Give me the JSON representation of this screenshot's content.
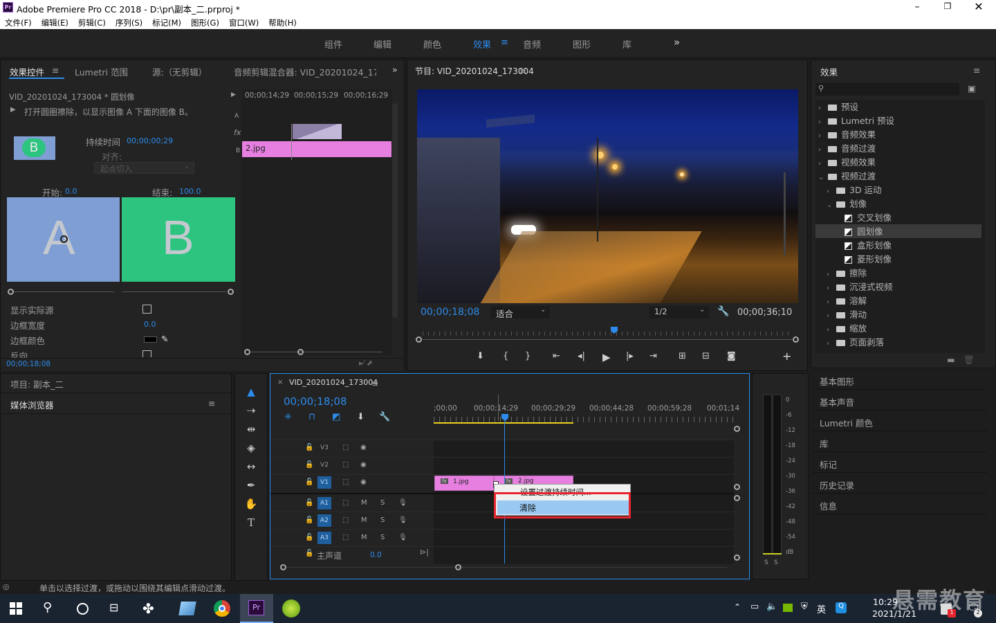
{
  "window": {
    "title": "Adobe Premiere Pro CC 2018 - D:\\pr\\副本_二.prproj *",
    "logo": "Pr"
  },
  "menu": [
    "文件(F)",
    "编辑(E)",
    "剪辑(C)",
    "序列(S)",
    "标记(M)",
    "图形(G)",
    "窗口(W)",
    "帮助(H)"
  ],
  "workspaces": {
    "items": [
      "组件",
      "编辑",
      "颜色",
      "效果",
      "音频",
      "图形",
      "库"
    ],
    "active": "效果",
    "more": "»"
  },
  "effect_controls": {
    "tabs": [
      "效果控件",
      "Lumetri 范围",
      "源:（无剪辑）",
      "音频剪辑混合器: VID_20201024_17300"
    ],
    "clip_title": "VID_20201024_173004 * 圆划像",
    "description": "打开圆圈擦除，以显示图像 A 下面的图像 B。",
    "thumb_letter": "B",
    "duration_label": "持续时间",
    "duration_value": "00;00;00;29",
    "align_label": "对齐:",
    "align_value": "起点切入",
    "start_label": "开始:",
    "start_value": "0.0",
    "end_label": "结束:",
    "end_value": "100.0",
    "preview_a": "A",
    "preview_b": "B",
    "props": [
      {
        "label": "显示实际源",
        "value": ""
      },
      {
        "label": "边框宽度",
        "value": "0.0"
      },
      {
        "label": "边框颜色",
        "value": ""
      },
      {
        "label": "反向",
        "value": ""
      }
    ],
    "timecode_bottom": "00;00;18;08",
    "mini_ruler": [
      "00;00;14;29",
      "00;00;15;29",
      "00;00;16;29"
    ],
    "mini_clip": "2.jpg",
    "track_a": "A",
    "track_b": "B",
    "fx_label": "fx"
  },
  "program": {
    "title": "节目: VID_20201024_173004",
    "timecode": "00;00;18;08",
    "fit": "适合",
    "quality": "1/2",
    "duration": "00;00;36;10"
  },
  "effects": {
    "title": "效果",
    "items": [
      {
        "label": "预设",
        "kind": "preset",
        "indent": 0,
        "chev": "›"
      },
      {
        "label": "Lumetri 预设",
        "kind": "preset",
        "indent": 0,
        "chev": "›"
      },
      {
        "label": "音频效果",
        "kind": "folder",
        "indent": 0,
        "chev": "›"
      },
      {
        "label": "音频过渡",
        "kind": "folder",
        "indent": 0,
        "chev": "›"
      },
      {
        "label": "视频效果",
        "kind": "folder",
        "indent": 0,
        "chev": "›"
      },
      {
        "label": "视频过渡",
        "kind": "folder",
        "indent": 0,
        "chev": "⌄"
      },
      {
        "label": "3D 运动",
        "kind": "folder",
        "indent": 1,
        "chev": "›"
      },
      {
        "label": "划像",
        "kind": "folder",
        "indent": 1,
        "chev": "⌄"
      },
      {
        "label": "交叉划像",
        "kind": "trans",
        "indent": 2,
        "chev": ""
      },
      {
        "label": "圆划像",
        "kind": "trans",
        "indent": 2,
        "chev": "",
        "selected": true
      },
      {
        "label": "盒形划像",
        "kind": "trans",
        "indent": 2,
        "chev": ""
      },
      {
        "label": "菱形划像",
        "kind": "trans",
        "indent": 2,
        "chev": ""
      },
      {
        "label": "擦除",
        "kind": "folder",
        "indent": 1,
        "chev": "›"
      },
      {
        "label": "沉浸式视频",
        "kind": "folder",
        "indent": 1,
        "chev": "›"
      },
      {
        "label": "溶解",
        "kind": "folder",
        "indent": 1,
        "chev": "›"
      },
      {
        "label": "滑动",
        "kind": "folder",
        "indent": 1,
        "chev": "›"
      },
      {
        "label": "缩放",
        "kind": "folder",
        "indent": 1,
        "chev": "›"
      },
      {
        "label": "页面剥落",
        "kind": "folder",
        "indent": 1,
        "chev": "›"
      }
    ],
    "panels": [
      "基本图形",
      "基本声音",
      "Lumetri 颜色",
      "库",
      "标记",
      "历史记录",
      "信息"
    ]
  },
  "project": {
    "title": "项目: 副本_二",
    "browser": "媒体浏览器"
  },
  "timeline": {
    "title": "VID_20201024_173004",
    "timecode": "00;00;18;08",
    "ruler": [
      ";00;00",
      "00;00;14;29",
      "00;00;29;29",
      "00;00;44;28",
      "00;00;59;28",
      "00;01;14"
    ],
    "video_tracks": [
      "V3",
      "V2",
      "V1"
    ],
    "audio_tracks": [
      "A1",
      "A2",
      "A3"
    ],
    "master": "主声道",
    "master_value": "0.0",
    "clip1": "1.jpg",
    "clip2": "2.jpg",
    "fx_badge": "fx",
    "m": "M",
    "s": "S",
    "context_menu": [
      "设置过渡持续时间...",
      "清除"
    ]
  },
  "meter": {
    "labels": [
      "0",
      "-6",
      "-12",
      "-18",
      "-24",
      "-30",
      "-36",
      "-42",
      "-48",
      "-54",
      "dB"
    ],
    "solo": [
      "S",
      "S"
    ]
  },
  "status": "单击以选择过渡，或拖动以围绕其编辑点滑动过渡。",
  "taskbar": {
    "time": "10:29",
    "date": "2021/1/21",
    "ime": "英",
    "watermark": "悬需教育",
    "badge1": "1",
    "badge2": "2"
  },
  "colors": {
    "accent": "#2d8ceb",
    "clip_pink": "#e67fe0",
    "clip_a": "#7f9fd4",
    "clip_b": "#2cc47f",
    "red": "#e6262e"
  }
}
